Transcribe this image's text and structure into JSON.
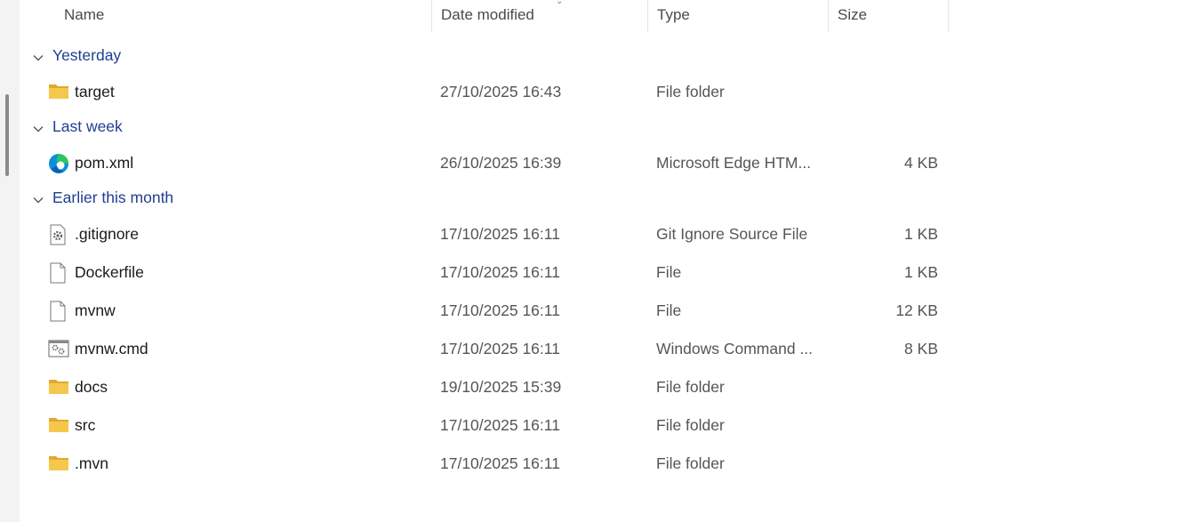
{
  "columns": {
    "name": "Name",
    "date_modified": "Date modified",
    "type": "Type",
    "size": "Size"
  },
  "groups": [
    {
      "label": "Yesterday",
      "files": [
        {
          "name": "target",
          "icon": "folder-icon",
          "date": "27/10/2025 16:43",
          "type": "File folder",
          "size": ""
        }
      ]
    },
    {
      "label": "Last week",
      "files": [
        {
          "name": "pom.xml",
          "icon": "edge-icon",
          "date": "26/10/2025 16:39",
          "type": "Microsoft Edge HTM...",
          "size": "4 KB"
        }
      ]
    },
    {
      "label": "Earlier this month",
      "files": [
        {
          "name": ".gitignore",
          "icon": "settings-file-icon",
          "date": "17/10/2025 16:11",
          "type": "Git Ignore Source File",
          "size": "1 KB"
        },
        {
          "name": "Dockerfile",
          "icon": "blank-file-icon",
          "date": "17/10/2025 16:11",
          "type": "File",
          "size": "1 KB"
        },
        {
          "name": "mvnw",
          "icon": "blank-file-icon",
          "date": "17/10/2025 16:11",
          "type": "File",
          "size": "12 KB"
        },
        {
          "name": "mvnw.cmd",
          "icon": "cmd-file-icon",
          "date": "17/10/2025 16:11",
          "type": "Windows Command ...",
          "size": "8 KB"
        },
        {
          "name": "docs",
          "icon": "folder-icon",
          "date": "19/10/2025 15:39",
          "type": "File folder",
          "size": ""
        },
        {
          "name": "src",
          "icon": "folder-icon",
          "date": "17/10/2025 16:11",
          "type": "File folder",
          "size": ""
        },
        {
          "name": ".mvn",
          "icon": "folder-icon",
          "date": "17/10/2025 16:11",
          "type": "File folder",
          "size": ""
        }
      ]
    }
  ],
  "colors": {
    "group_label": "#1f3f8f",
    "folder": "#f5c84c",
    "folder_dark": "#e0a82e"
  }
}
